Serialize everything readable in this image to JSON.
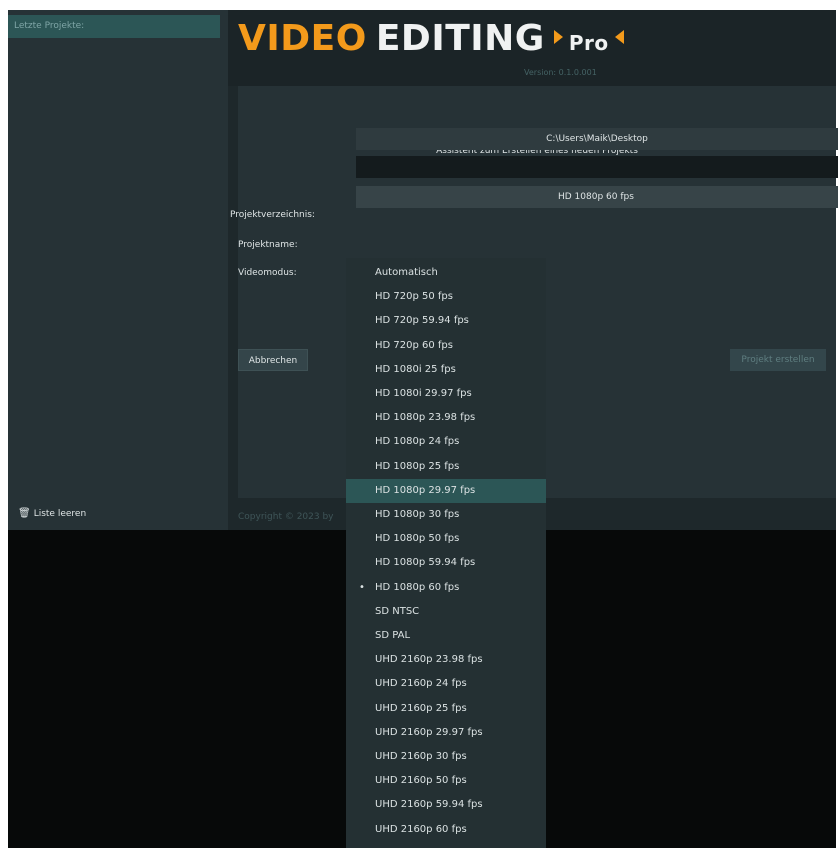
{
  "sidebar": {
    "recent_label": "Letzte Projekte:",
    "clear_label": "Liste leeren",
    "clear_icon": "trash-icon"
  },
  "header": {
    "logo_video": "VIDEO",
    "logo_editing": "EDITING",
    "logo_pro": "Pro",
    "version": "Version: 0.1.0.001",
    "accent_color": "#f39a1b"
  },
  "form": {
    "assistant_text": "Assistent zum Erstellen eines neuen Projekts",
    "dir_label": "Projektverzeichnis:",
    "dir_value": "C:\\Users\\Maik\\Desktop",
    "name_label": "Projektname:",
    "name_value": "",
    "mode_label": "Videomodus:",
    "mode_value": "HD 1080p 60 fps",
    "cancel_label": "Abbrechen",
    "create_label": "Projekt erstellen",
    "copyright": "Copyright © 2023 by"
  },
  "dropdown": {
    "highlighted": "HD 1080p 29.97 fps",
    "selected": "HD 1080p 60 fps",
    "items": [
      "Automatisch",
      "HD 720p 50 fps",
      "HD 720p 59.94 fps",
      "HD 720p 60 fps",
      "HD 1080i 25 fps",
      "HD 1080i 29.97 fps",
      "HD 1080p 23.98 fps",
      "HD 1080p 24 fps",
      "HD 1080p 25 fps",
      "HD 1080p 29.97 fps",
      "HD 1080p 30 fps",
      "HD 1080p 50 fps",
      "HD 1080p 59.94 fps",
      "HD 1080p 60 fps",
      "SD NTSC",
      "SD PAL",
      "UHD 2160p 23.98 fps",
      "UHD 2160p 24 fps",
      "UHD 2160p 25 fps",
      "UHD 2160p 29.97 fps",
      "UHD 2160p 30 fps",
      "UHD 2160p 50 fps",
      "UHD 2160p 59.94 fps",
      "UHD 2160p 60 fps"
    ]
  }
}
